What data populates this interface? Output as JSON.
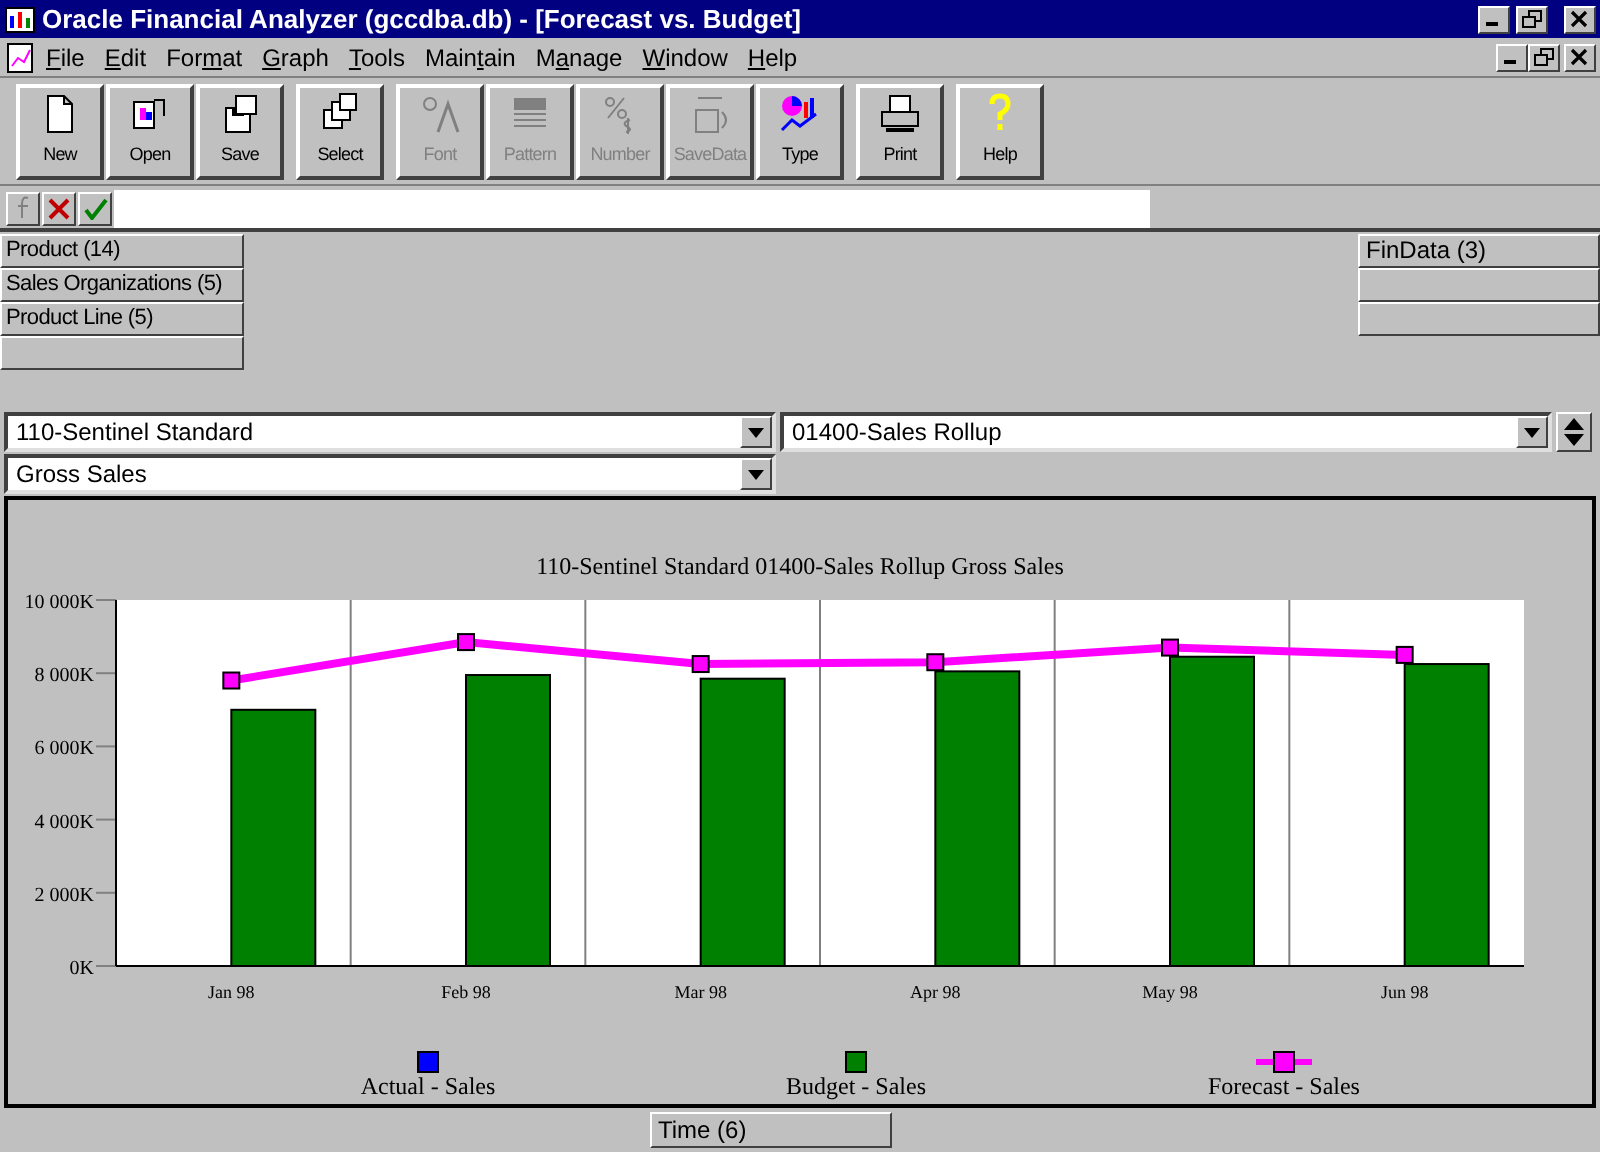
{
  "window": {
    "title": "Oracle Financial Analyzer (gccdba.db) - [Forecast vs. Budget]"
  },
  "menu": [
    {
      "label": "File"
    },
    {
      "label": "Edit"
    },
    {
      "label": "Format"
    },
    {
      "label": "Graph"
    },
    {
      "label": "Tools"
    },
    {
      "label": "Maintain"
    },
    {
      "label": "Manage"
    },
    {
      "label": "Window"
    },
    {
      "label": "Help"
    }
  ],
  "toolbar": [
    {
      "label": "New",
      "kind": "new",
      "disabled": false
    },
    {
      "label": "Open",
      "kind": "open",
      "disabled": false
    },
    {
      "label": "Save",
      "kind": "save",
      "disabled": false
    },
    {
      "label": "Select",
      "kind": "select",
      "disabled": false
    },
    {
      "label": "Font",
      "kind": "font",
      "disabled": true
    },
    {
      "label": "Pattern",
      "kind": "pattern",
      "disabled": true
    },
    {
      "label": "Number",
      "kind": "number",
      "disabled": true
    },
    {
      "label": "SaveData",
      "kind": "savedata",
      "disabled": true
    },
    {
      "label": "Type",
      "kind": "type",
      "disabled": false
    },
    {
      "label": "Print",
      "kind": "print",
      "disabled": false
    },
    {
      "label": "Help",
      "kind": "help",
      "disabled": false
    }
  ],
  "page_dimensions": [
    "Product (14)",
    "Sales Organizations (5)",
    "Product Line (5)"
  ],
  "column_dimensions": [
    "FinData (3)"
  ],
  "selectors": [
    {
      "value": "110-Sentinel Standard"
    },
    {
      "value": "01400-Sales Rollup"
    },
    {
      "value": "Gross Sales"
    }
  ],
  "chart": {
    "chart_data": {
      "type": "bar",
      "title": "110-Sentinel Standard 01400-Sales Rollup Gross Sales",
      "categories": [
        "Jan 98",
        "Feb 98",
        "Mar 98",
        "Apr 98",
        "May 98",
        "Jun 98"
      ],
      "ylim": [
        0,
        10000
      ],
      "legend": "bottom",
      "yticks": [
        {
          "value": 0,
          "label": "0K"
        },
        {
          "value": 2000,
          "label": "2 000K"
        },
        {
          "value": 4000,
          "label": "4 000K"
        },
        {
          "value": 6000,
          "label": "6 000K"
        },
        {
          "value": 8000,
          "label": "8 000K"
        },
        {
          "value": 10000,
          "label": "10 000K"
        }
      ],
      "series": [
        {
          "name": "Actual - Sales",
          "color": "#0000ff",
          "values": [
            null,
            null,
            null,
            null,
            null,
            null
          ]
        },
        {
          "name": "Budget - Sales",
          "color": "#008000",
          "values": [
            7000,
            7950,
            7850,
            8050,
            8450,
            8250
          ]
        },
        {
          "name": "Forecast - Sales",
          "color": "#ff00ff",
          "type": "line",
          "marker": "square",
          "values": [
            7800,
            8850,
            8250,
            8300,
            8700,
            8500
          ]
        }
      ]
    }
  },
  "row_dimensions": [
    "Time (6)"
  ]
}
